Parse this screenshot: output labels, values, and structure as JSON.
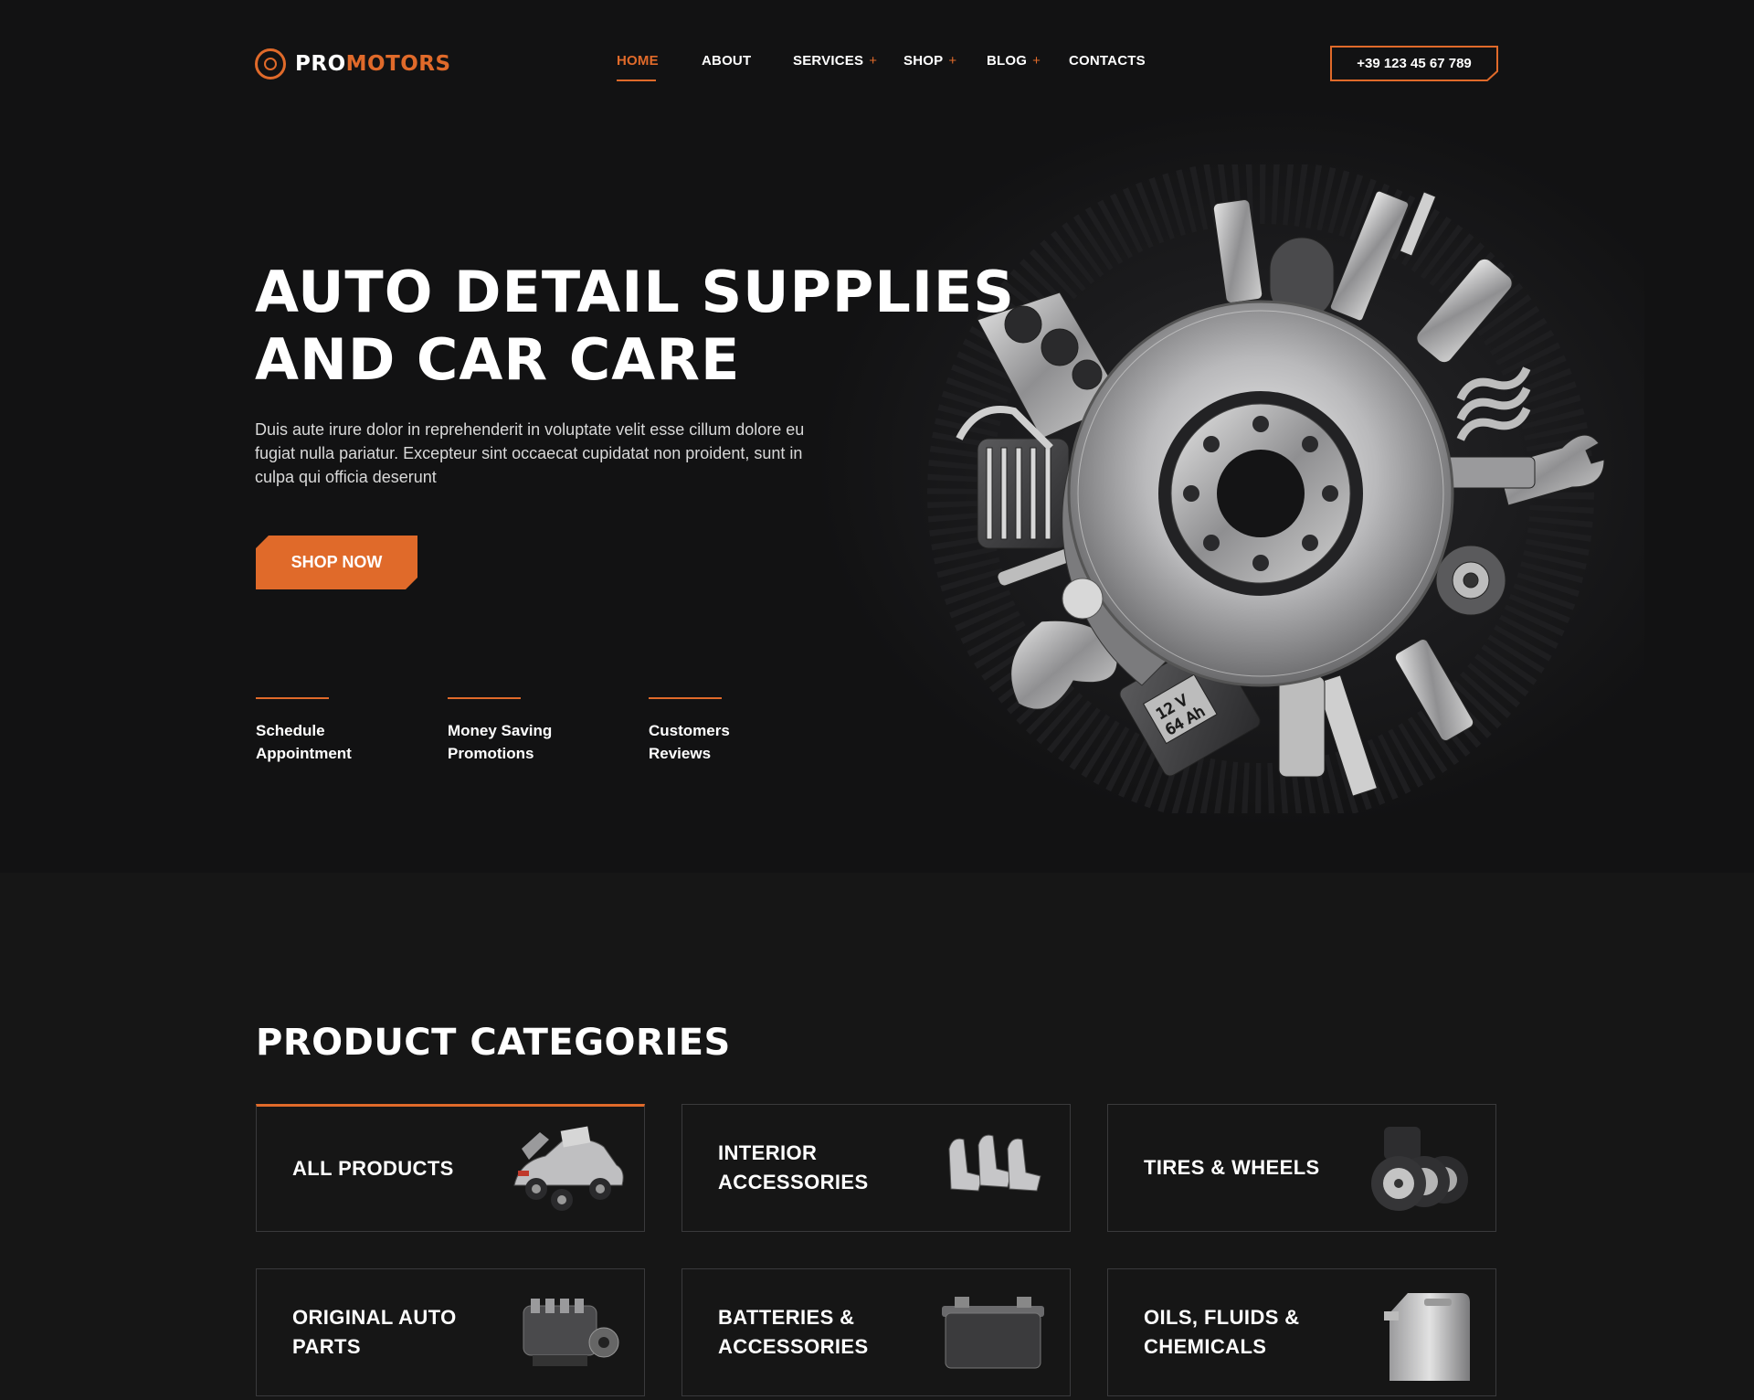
{
  "header": {
    "logo": {
      "part1": "PRO",
      "part2": "MOTORS"
    },
    "nav": [
      {
        "label": "HOME",
        "active": true,
        "has_submenu": false
      },
      {
        "label": "ABOUT",
        "active": false,
        "has_submenu": false
      },
      {
        "label": "SERVICES",
        "active": false,
        "has_submenu": true
      },
      {
        "label": "SHOP",
        "active": false,
        "has_submenu": true
      },
      {
        "label": "BLOG",
        "active": false,
        "has_submenu": true
      },
      {
        "label": "CONTACTS",
        "active": false,
        "has_submenu": false
      }
    ],
    "submenu_marker": "+",
    "phone": "+39 123 45 67 789"
  },
  "hero": {
    "title_line1": "AUTO DETAIL SUPPLIES",
    "title_line2": "AND CAR CARE",
    "description": "Duis aute irure dolor in reprehenderit in voluptate velit esse cillum dolore eu fugiat nulla pariatur. Excepteur sint occaecat cupidatat non proident, sunt in culpa qui officia deserunt",
    "cta": "SHOP NOW",
    "features": [
      {
        "line1": "Schedule",
        "line2": "Appointment"
      },
      {
        "line1": "Money Saving",
        "line2": "Promotions"
      },
      {
        "line1": "Customers",
        "line2": "Reviews"
      }
    ],
    "image_labels": {
      "battery_voltage": "12 V",
      "battery_capacity": "64 Ah"
    }
  },
  "categories": {
    "title": "PRODUCT CATEGORIES",
    "items": [
      {
        "label": "ALL PRODUCTS",
        "icon": "car-icon",
        "active": true
      },
      {
        "label": "INTERIOR ACCESSORIES",
        "icon": "car-seats-icon",
        "active": false
      },
      {
        "label": "TIRES & WHEELS",
        "icon": "tires-icon",
        "active": false
      },
      {
        "label": "ORIGINAL AUTO PARTS",
        "icon": "engine-icon",
        "active": false
      },
      {
        "label": "BATTERIES & ACCESSORIES",
        "icon": "battery-icon",
        "active": false
      },
      {
        "label": "OILS, FLUIDS & CHEMICALS",
        "icon": "canister-icon",
        "active": false
      }
    ]
  },
  "colors": {
    "accent": "#e06a2a",
    "background": "#161616",
    "hero_background": "#121213",
    "card_border": "#3a3a3c",
    "text": "#ffffff"
  }
}
